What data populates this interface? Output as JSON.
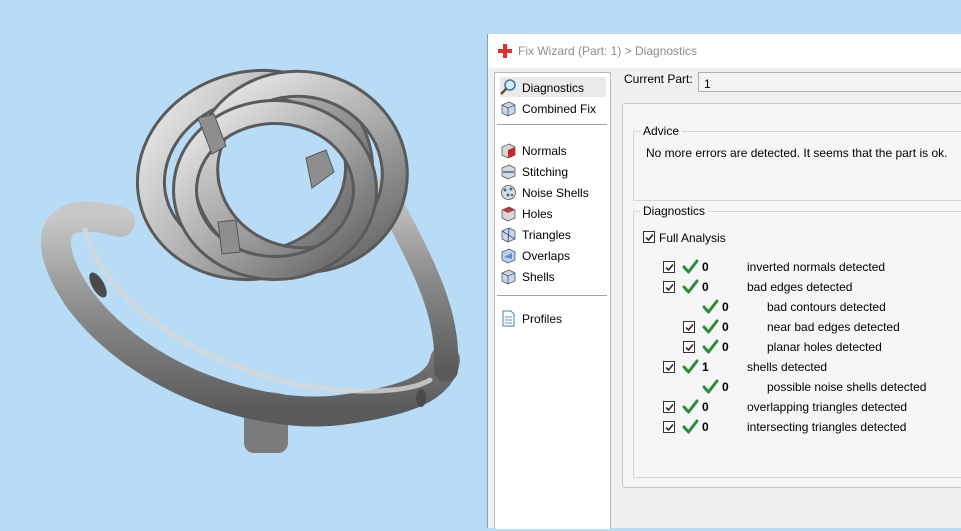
{
  "window": {
    "title": "Fix Wizard (Part: 1) > Diagnostics"
  },
  "sidebar": {
    "top_items": [
      {
        "label": "Diagnostics",
        "icon": "magnifier-icon",
        "selected": true
      },
      {
        "label": "Combined Fix",
        "icon": "cube-icon",
        "selected": false
      }
    ],
    "items": [
      {
        "label": "Normals",
        "icon": "normals-icon"
      },
      {
        "label": "Stitching",
        "icon": "stitching-icon"
      },
      {
        "label": "Noise Shells",
        "icon": "noise-shells-icon"
      },
      {
        "label": "Holes",
        "icon": "holes-icon"
      },
      {
        "label": "Triangles",
        "icon": "triangles-icon"
      },
      {
        "label": "Overlaps",
        "icon": "overlaps-icon"
      },
      {
        "label": "Shells",
        "icon": "shells-icon"
      }
    ],
    "bottom_items": [
      {
        "label": "Profiles",
        "icon": "document-icon"
      }
    ]
  },
  "current_part": {
    "label": "Current Part:",
    "value": "1"
  },
  "advice": {
    "title": "Advice",
    "text": "No more errors are detected. It seems that the part is ok."
  },
  "diagnostics": {
    "title": "Diagnostics",
    "full_analysis_label": "Full Analysis",
    "full_analysis_checked": true,
    "rows": [
      {
        "indent": 0,
        "checkbox": true,
        "count": "0",
        "text": "inverted normals detected"
      },
      {
        "indent": 0,
        "checkbox": true,
        "count": "0",
        "text": "bad edges detected"
      },
      {
        "indent": 1,
        "checkbox": false,
        "count": "0",
        "text": "bad contours detected"
      },
      {
        "indent": 1,
        "checkbox": true,
        "count": "0",
        "text": "near bad edges detected"
      },
      {
        "indent": 1,
        "checkbox": true,
        "count": "0",
        "text": "planar holes detected"
      },
      {
        "indent": 0,
        "checkbox": true,
        "count": "1",
        "text": "shells detected"
      },
      {
        "indent": 1,
        "checkbox": false,
        "count": "0",
        "text": "possible noise shells detected"
      },
      {
        "indent": 0,
        "checkbox": true,
        "count": "0",
        "text": "overlapping triangles detected"
      },
      {
        "indent": 0,
        "checkbox": true,
        "count": "0",
        "text": "intersecting triangles detected"
      }
    ]
  },
  "colors": {
    "viewport_bg": "#b8dcf6",
    "check_green": "#2e8b3a",
    "title_icon_red": "#e03030"
  }
}
